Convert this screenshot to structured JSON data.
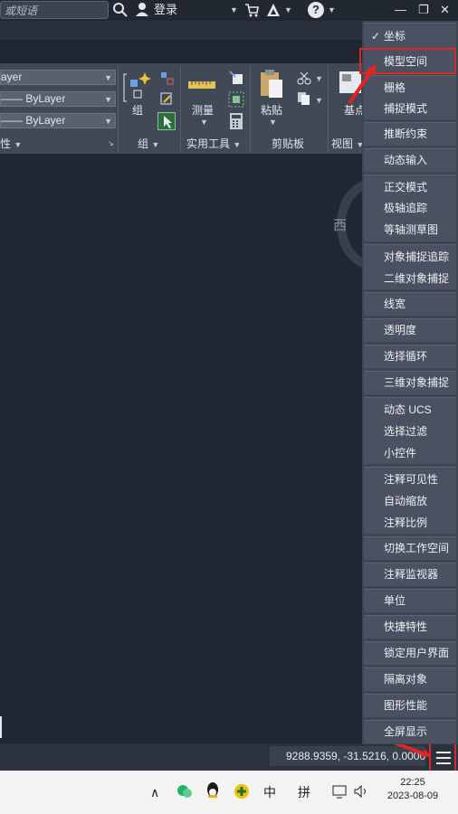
{
  "titlebar": {
    "search_placeholder": "或短语",
    "login_label": "登录",
    "help_symbol": "?",
    "window_controls": [
      "—",
      "❐",
      "✕"
    ]
  },
  "ribbon": {
    "layer_value": "ayer",
    "linetype_value": "—— ByLayer",
    "lineweight_value": "—— ByLayer",
    "properties_panel": "性",
    "group_button": "组",
    "group_panel": "组",
    "measure_button": "测量",
    "utilities_panel": "实用工具",
    "paste_button": "粘贴",
    "clipboard_panel": "剪贴板",
    "base_button": "基点",
    "view_panel": "视图"
  },
  "drawing": {
    "compass_west": "西"
  },
  "menu": {
    "groups": [
      {
        "items": [
          {
            "label": "坐标",
            "checked": true
          },
          {
            "label": "模型空间",
            "checked": false
          }
        ]
      },
      {
        "items": [
          {
            "label": "栅格"
          },
          {
            "label": "捕捉模式"
          }
        ]
      },
      {
        "items": [
          {
            "label": "推断约束"
          }
        ]
      },
      {
        "items": [
          {
            "label": "动态输入"
          }
        ]
      },
      {
        "items": [
          {
            "label": "正交模式"
          },
          {
            "label": "极轴追踪"
          },
          {
            "label": "等轴测草图"
          }
        ]
      },
      {
        "items": [
          {
            "label": "对象捕捉追踪"
          },
          {
            "label": "二维对象捕捉"
          }
        ]
      },
      {
        "items": [
          {
            "label": "线宽"
          }
        ]
      },
      {
        "items": [
          {
            "label": "透明度"
          }
        ]
      },
      {
        "items": [
          {
            "label": "选择循环"
          }
        ]
      },
      {
        "items": [
          {
            "label": "三维对象捕捉"
          }
        ]
      },
      {
        "items": [
          {
            "label": "动态 UCS"
          },
          {
            "label": "选择过滤"
          },
          {
            "label": "小控件"
          }
        ]
      },
      {
        "items": [
          {
            "label": "注释可见性"
          },
          {
            "label": "自动缩放"
          },
          {
            "label": "注释比例"
          }
        ]
      },
      {
        "items": [
          {
            "label": "切换工作空间"
          }
        ]
      },
      {
        "items": [
          {
            "label": "注释监视器"
          }
        ]
      },
      {
        "items": [
          {
            "label": "单位"
          }
        ]
      },
      {
        "items": [
          {
            "label": "快捷特性"
          }
        ]
      },
      {
        "items": [
          {
            "label": "锁定用户界面"
          }
        ]
      },
      {
        "items": [
          {
            "label": "隔离对象"
          }
        ]
      },
      {
        "items": [
          {
            "label": "图形性能"
          }
        ]
      },
      {
        "items": [
          {
            "label": "全屏显示"
          }
        ]
      }
    ]
  },
  "statusbar": {
    "coordinates": "9288.9359, -31.5216, 0.0000"
  },
  "taskbar": {
    "ime_chinese": "中",
    "ime_pinyin": "拼",
    "time": "22:25",
    "date": "2023-08-09"
  },
  "colors": {
    "accent_red": "#e02525",
    "menu_bg": "#4a5261",
    "drawing_bg": "#222833"
  }
}
